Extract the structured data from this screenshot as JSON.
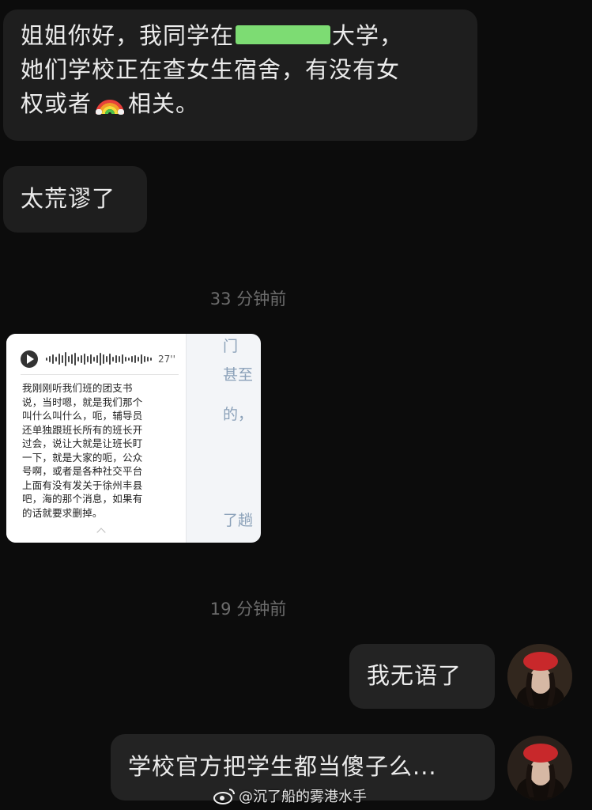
{
  "messages": {
    "msg1": {
      "line1_before": "姐姐你好，我同学在",
      "line1_after": "大学，",
      "line2": "她们学校正在查女生宿舍，有没有女",
      "line3_before": "权或者",
      "line3_after": "相关。",
      "emoji": "rainbow-icon"
    },
    "msg2": "太荒谬了",
    "msg3": "我无语了",
    "msg4": "学校官方把学生都当傻子么..."
  },
  "timestamps": {
    "t1": "33 分钟前",
    "t2": "19 分钟前"
  },
  "image_card": {
    "duration": "27''",
    "transcript": "我刚刚听我们班的团支书\n说，当时嗯，就是我们那个\n叫什么叫什么，呃，辅导员\n还单独跟班长所有的班长开\n过会，说让大就是让班长盯\n一下，就是大家的呃，公众\n号啊，或者是各种社交平台\n上面有没有发关于徐州丰县\n吧，海的那个消息，如果有\n的话就要求删掉。",
    "side_fragments": [
      "门",
      "甚至",
      "的，",
      "了趟"
    ]
  },
  "watermark": "@沉了船的雾港水手",
  "colors": {
    "background": "#0c0c0c",
    "bubble": "#1e1e1e",
    "text": "#ececec",
    "timestamp": "#6c6c6c",
    "redaction": "#7ddc73"
  }
}
